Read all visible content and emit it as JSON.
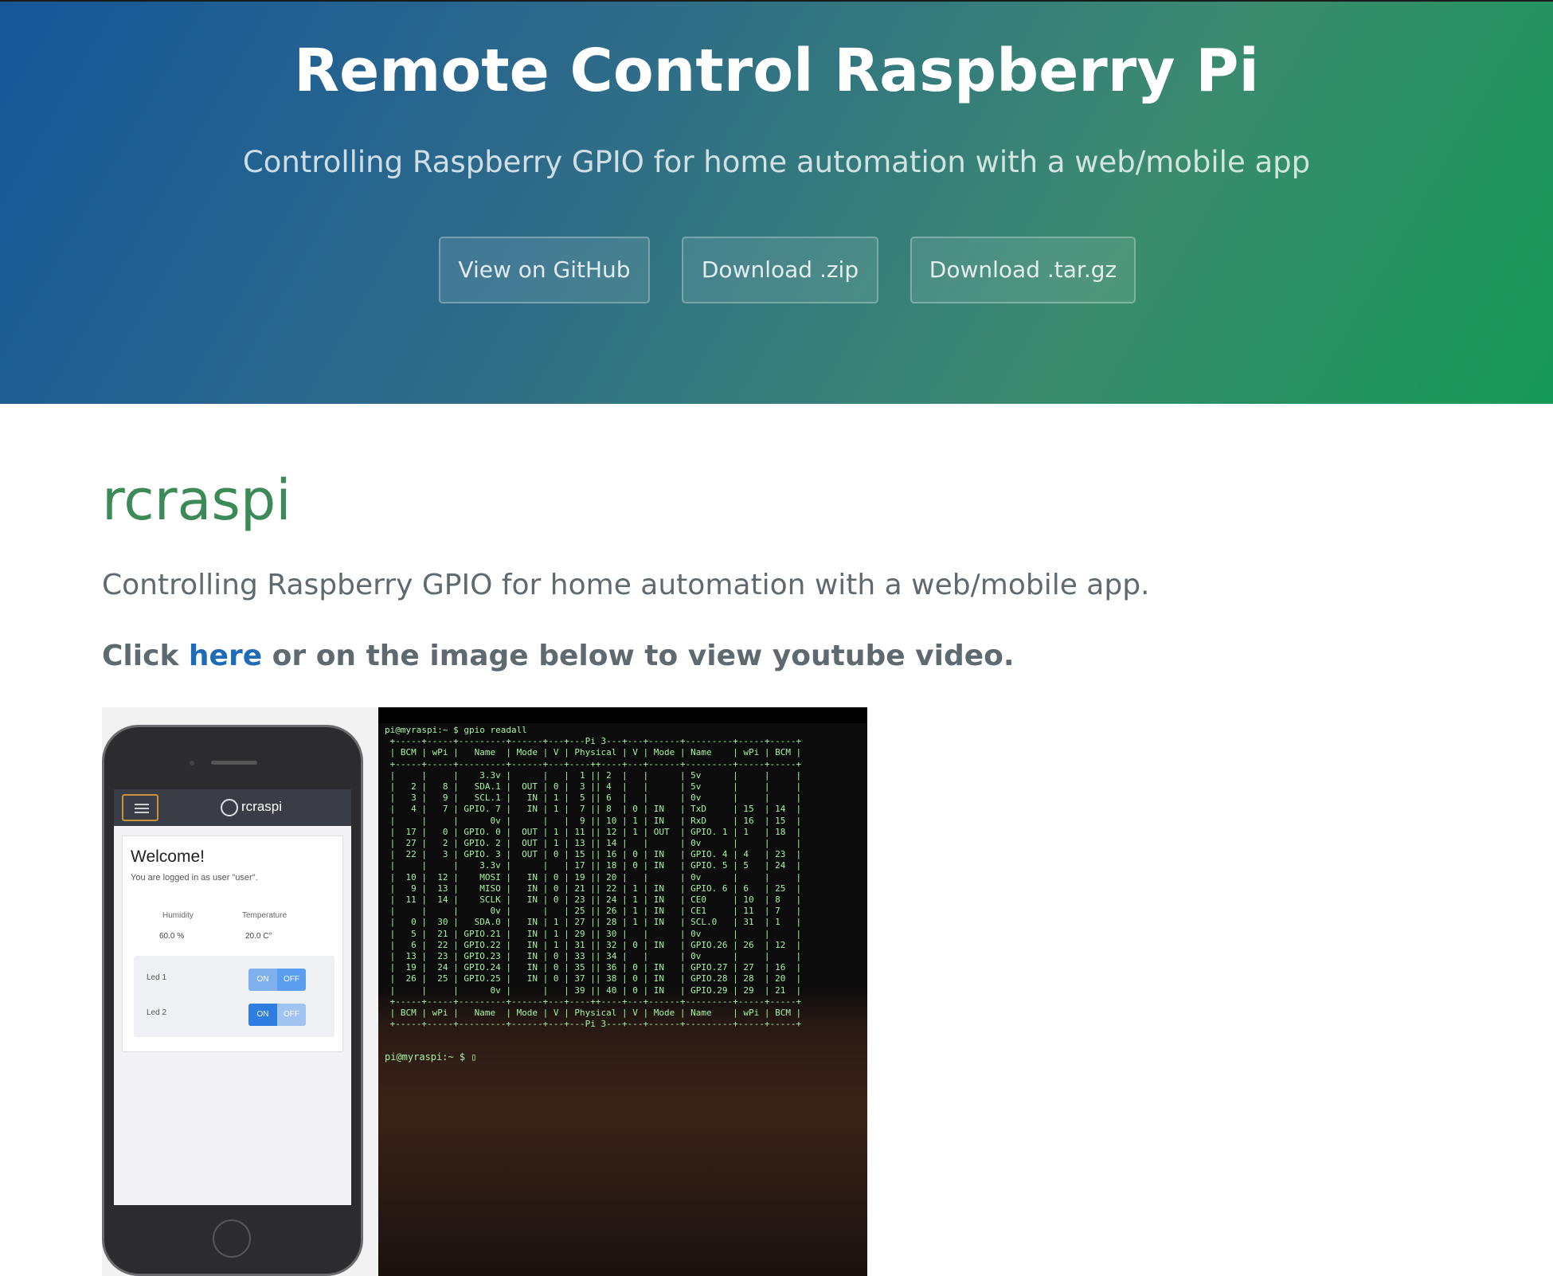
{
  "header": {
    "title": "Remote Control Raspberry Pi",
    "tagline": "Controlling Raspberry GPIO for home automation with a web/mobile app",
    "buttons": [
      "View on GitHub",
      "Download .zip",
      "Download .tar.gz"
    ]
  },
  "main": {
    "heading": "rcraspi",
    "description": "Controlling Raspberry GPIO for home automation with a web/mobile app.",
    "cta_before": "Click ",
    "cta_link": "here",
    "cta_after": " or on the image below to view youtube video."
  },
  "thumbnail": {
    "app_title": "rcraspi",
    "welcome": "Welcome!",
    "logged_in": "You are logged in as user \"user\".",
    "humidity_label": "Humidity",
    "temperature_label": "Temperature",
    "humidity_value": "60.0 %",
    "temperature_value": "20.0 C°",
    "leds": [
      {
        "name": "Led 1",
        "on": "ON",
        "off": "OFF"
      },
      {
        "name": "Led 2",
        "on": "ON",
        "off": "OFF"
      }
    ],
    "terminal_command": "pi@myraspi:~ $ gpio readall",
    "terminal_prompt": "pi@myraspi:~ $ ▯",
    "terminal_lines": [
      " +-----+-----+---------+------+---+---Pi 3---+---+------+---------+-----+-----+",
      " | BCM | wPi |   Name  | Mode | V | Physical | V | Mode | Name    | wPi | BCM |",
      " +-----+-----+---------+------+---+----++----+---+------+---------+-----+-----+",
      " |     |     |    3.3v |      |   |  1 || 2  |   |      | 5v      |     |     |",
      " |   2 |   8 |   SDA.1 |  OUT | 0 |  3 || 4  |   |      | 5v      |     |     |",
      " |   3 |   9 |   SCL.1 |   IN | 1 |  5 || 6  |   |      | 0v      |     |     |",
      " |   4 |   7 | GPIO. 7 |   IN | 1 |  7 || 8  | 0 | IN   | TxD     | 15  | 14  |",
      " |     |     |      0v |      |   |  9 || 10 | 1 | IN   | RxD     | 16  | 15  |",
      " |  17 |   0 | GPIO. 0 |  OUT | 1 | 11 || 12 | 1 | OUT  | GPIO. 1 | 1   | 18  |",
      " |  27 |   2 | GPIO. 2 |  OUT | 1 | 13 || 14 |   |      | 0v      |     |     |",
      " |  22 |   3 | GPIO. 3 |  OUT | 0 | 15 || 16 | 0 | IN   | GPIO. 4 | 4   | 23  |",
      " |     |     |    3.3v |      |   | 17 || 18 | 0 | IN   | GPIO. 5 | 5   | 24  |",
      " |  10 |  12 |    MOSI |   IN | 0 | 19 || 20 |   |      | 0v      |     |     |",
      " |   9 |  13 |    MISO |   IN | 0 | 21 || 22 | 1 | IN   | GPIO. 6 | 6   | 25  |",
      " |  11 |  14 |    SCLK |   IN | 0 | 23 || 24 | 1 | IN   | CE0     | 10  | 8   |",
      " |     |     |      0v |      |   | 25 || 26 | 1 | IN   | CE1     | 11  | 7   |",
      " |   0 |  30 |   SDA.0 |   IN | 1 | 27 || 28 | 1 | IN   | SCL.0   | 31  | 1   |",
      " |   5 |  21 | GPIO.21 |   IN | 1 | 29 || 30 |   |      | 0v      |     |     |",
      " |   6 |  22 | GPIO.22 |   IN | 1 | 31 || 32 | 0 | IN   | GPIO.26 | 26  | 12  |",
      " |  13 |  23 | GPIO.23 |   IN | 0 | 33 || 34 |   |      | 0v      |     |     |",
      " |  19 |  24 | GPIO.24 |   IN | 0 | 35 || 36 | 0 | IN   | GPIO.27 | 27  | 16  |",
      " |  26 |  25 | GPIO.25 |   IN | 0 | 37 || 38 | 0 | IN   | GPIO.28 | 28  | 20  |",
      " |     |     |      0v |      |   | 39 || 40 | 0 | IN   | GPIO.29 | 29  | 21  |",
      " +-----+-----+---------+------+---+----++----+---+------+---------+-----+-----+",
      " | BCM | wPi |   Name  | Mode | V | Physical | V | Mode | Name    | wPi | BCM |",
      " +-----+-----+---------+------+---+---Pi 3---+---+------+---------+-----+-----+"
    ]
  },
  "colors": {
    "header_gradient_start": "#155799",
    "header_gradient_end": "#159957",
    "heading": "#3c8a57",
    "link": "#1e6bb8",
    "terminal_text": "#a6f2a0"
  }
}
